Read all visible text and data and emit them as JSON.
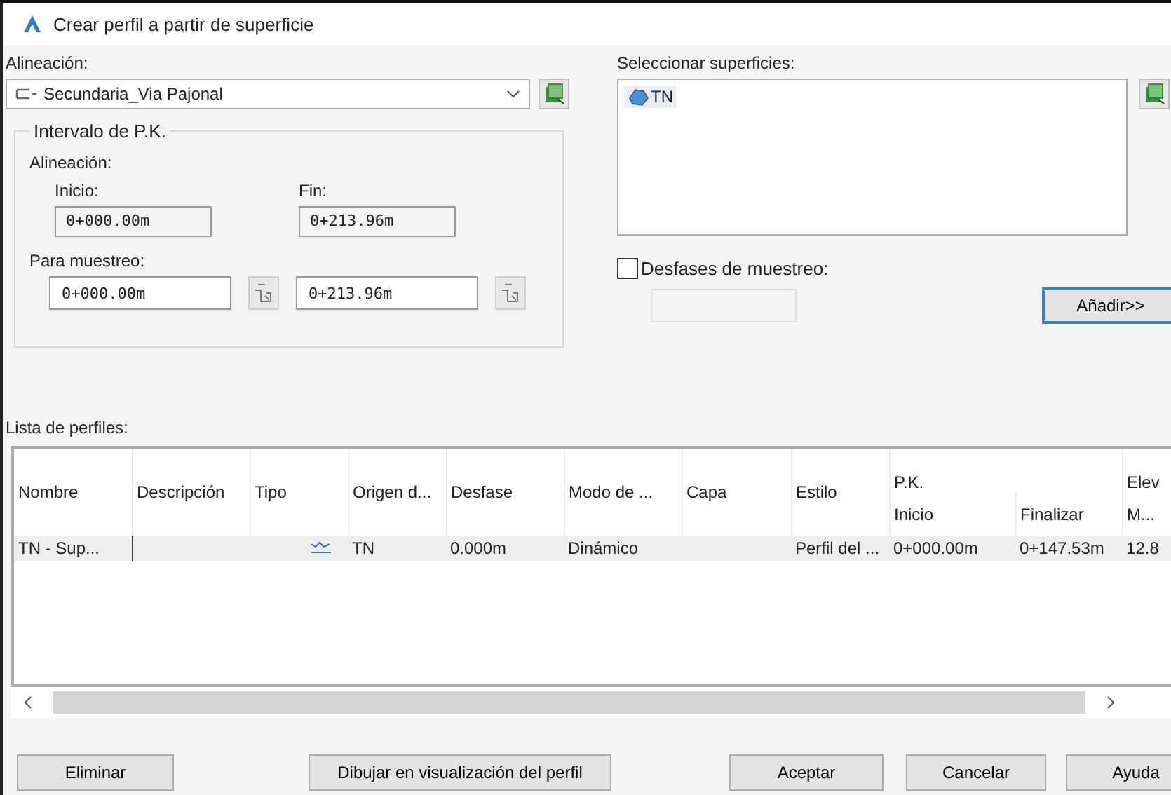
{
  "window": {
    "title": "Crear perfil a partir de superficie"
  },
  "alignment": {
    "label": "Alineación:",
    "value": "Secundaria_Via Pajonal"
  },
  "station_range": {
    "title": "Intervalo de P.K.",
    "alignment_label": "Alineación:",
    "start_label": "Inicio:",
    "start": "0+000.00m",
    "end_label": "Fin:",
    "end": "0+213.96m",
    "sample_label": "Para muestreo:",
    "sample_start": "0+000.00m",
    "sample_end": "0+213.96m"
  },
  "surfaces": {
    "label": "Seleccionar superficies:",
    "items": [
      {
        "name": "TN",
        "selected": true
      }
    ]
  },
  "sample_offsets": {
    "label": "Desfases de muestreo:",
    "checked": false
  },
  "add_button": "Añadir>>",
  "profile_list": {
    "label": "Lista de perfiles:",
    "columns": [
      {
        "label": "Nombre"
      },
      {
        "label": "Descripción"
      },
      {
        "label": "Tipo"
      },
      {
        "label": "Origen d..."
      },
      {
        "label": "Desfase"
      },
      {
        "label": "Modo de ..."
      },
      {
        "label": "Capa"
      },
      {
        "label": "Estilo"
      },
      {
        "label": "P.K.",
        "colspan": 2,
        "children": [
          "Inicio",
          "Finalizar"
        ]
      },
      {
        "label": "Elev",
        "children": [
          "M..."
        ]
      }
    ],
    "rows": [
      {
        "selected": true,
        "cells": [
          {
            "kind": "text",
            "text": "TN - Sup..."
          },
          {
            "kind": "empty"
          },
          {
            "kind": "profile-icon"
          },
          {
            "kind": "text",
            "text": "TN"
          },
          {
            "kind": "text",
            "text": "0.000m"
          },
          {
            "kind": "text",
            "text": "Dinámico"
          },
          {
            "kind": "empty"
          },
          {
            "kind": "text",
            "text": "Perfil del ..."
          },
          {
            "kind": "text",
            "text": "0+000.00m"
          },
          {
            "kind": "text",
            "text": "0+147.53m"
          },
          {
            "kind": "text",
            "text": "12.8"
          }
        ]
      }
    ]
  },
  "buttons": [
    "Eliminar",
    "Dibujar en visualización del perfil",
    "Aceptar",
    "Cancelar",
    "Ayuda"
  ]
}
